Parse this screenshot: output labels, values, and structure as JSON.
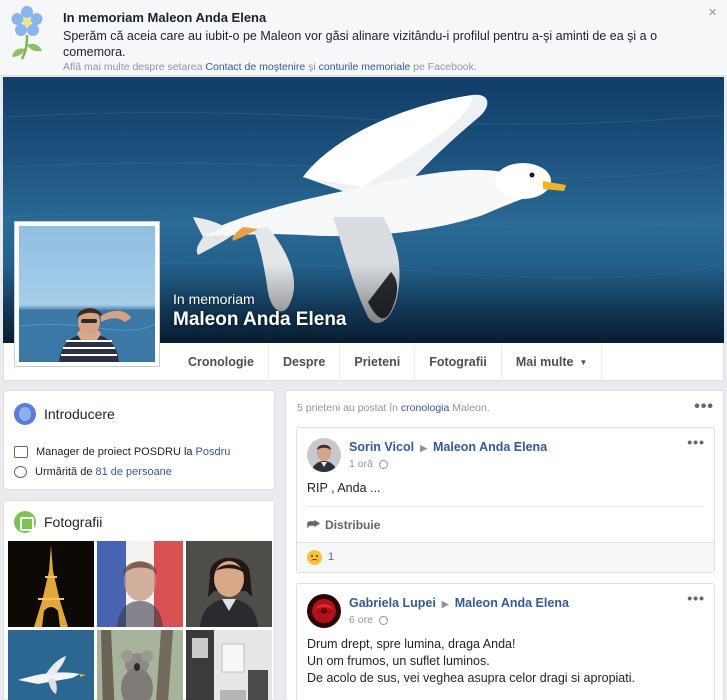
{
  "banner": {
    "title": "In memoriam Maleon Anda Elena",
    "text": "Sperăm că aceia care au iubit-o pe Maleon vor găsi alinare vizitându-i profilul pentru a-şi aminti de ea şi a o comemora.",
    "note_prefix": "Află mai multe despre setarea ",
    "note_link1": "Contact de moştenire",
    "note_mid": " şi ",
    "note_link2": "conturile memoriale",
    "note_suffix": " pe Facebook.",
    "close": "×"
  },
  "profile": {
    "subtitle": "In memoriam",
    "name": "Maleon Anda Elena"
  },
  "nav": {
    "tabs": [
      "Cronologie",
      "Despre",
      "Prieteni",
      "Fotografii",
      "Mai multe"
    ],
    "caret": "▼"
  },
  "intro": {
    "title": "Introducere",
    "job_prefix": "Manager de proiect POSDRU la ",
    "job_link": "Posdru",
    "follow_prefix": "Urmărită de ",
    "follow_link": "81 de persoane"
  },
  "photos": {
    "title": "Fotografii"
  },
  "feed": {
    "note_prefix": "5 prieteni au postat în ",
    "note_link": "cronologia",
    "note_suffix": " Maleon.",
    "more": "•••"
  },
  "posts": [
    {
      "author": "Sorin Vicol",
      "target": "Maleon Anda Elena",
      "time": "1 oră",
      "lines": [
        "RIP , Anda ..."
      ],
      "share": "Distribuie",
      "reaction_count": "1"
    },
    {
      "author": "Gabriela Lupei",
      "target": "Maleon Anda Elena",
      "time": "6 ore",
      "lines": [
        "Drum drept, spre lumina, draga Anda!",
        "Un om frumos, un suflet luminos.",
        "De acolo de sus, vei veghea asupra celor dragi si apropiati."
      ]
    }
  ],
  "colors": {
    "link": "#365899",
    "muted": "#90949c",
    "page_bg": "#e9ebee"
  }
}
